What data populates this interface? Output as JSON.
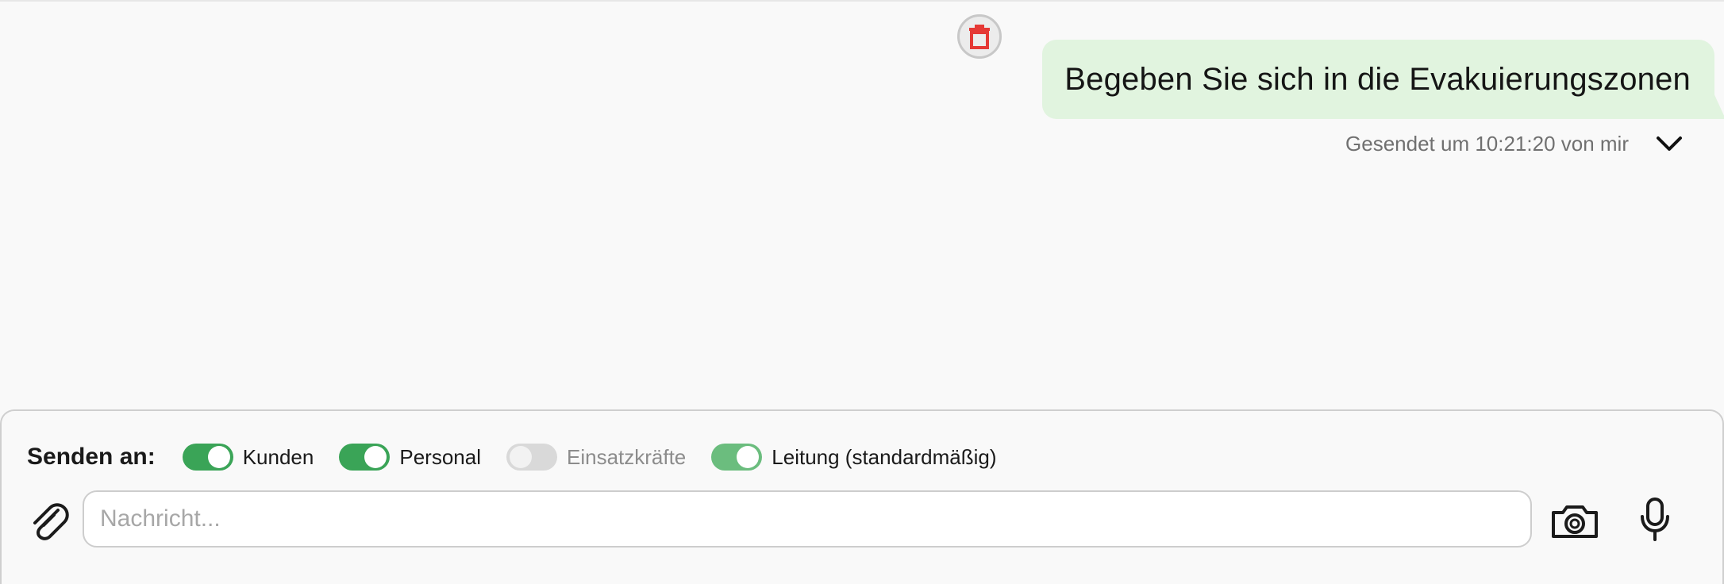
{
  "message": {
    "text": "Begeben Sie sich in die Evakuierungszonen",
    "meta": "Gesendet um 10:21:20 von mir",
    "delete_icon": "trash-icon",
    "expand_icon": "chevron-down-icon"
  },
  "composer": {
    "send_label": "Senden an:",
    "recipients": [
      {
        "label": "Kunden",
        "enabled": true
      },
      {
        "label": "Personal",
        "enabled": true
      },
      {
        "label": "Einsatzkräfte",
        "enabled": false
      },
      {
        "label": "Leitung (standardmäßig)",
        "enabled": true
      }
    ],
    "input_placeholder": "Nachricht...",
    "input_value": "",
    "attach_icon": "paperclip-icon",
    "camera_icon": "camera-icon",
    "mic_icon": "microphone-icon"
  },
  "colors": {
    "bubble": "#e1f4df",
    "toggle_on": "#3aa457",
    "toggle_off": "#d9d9d9",
    "trash": "#e53935"
  }
}
